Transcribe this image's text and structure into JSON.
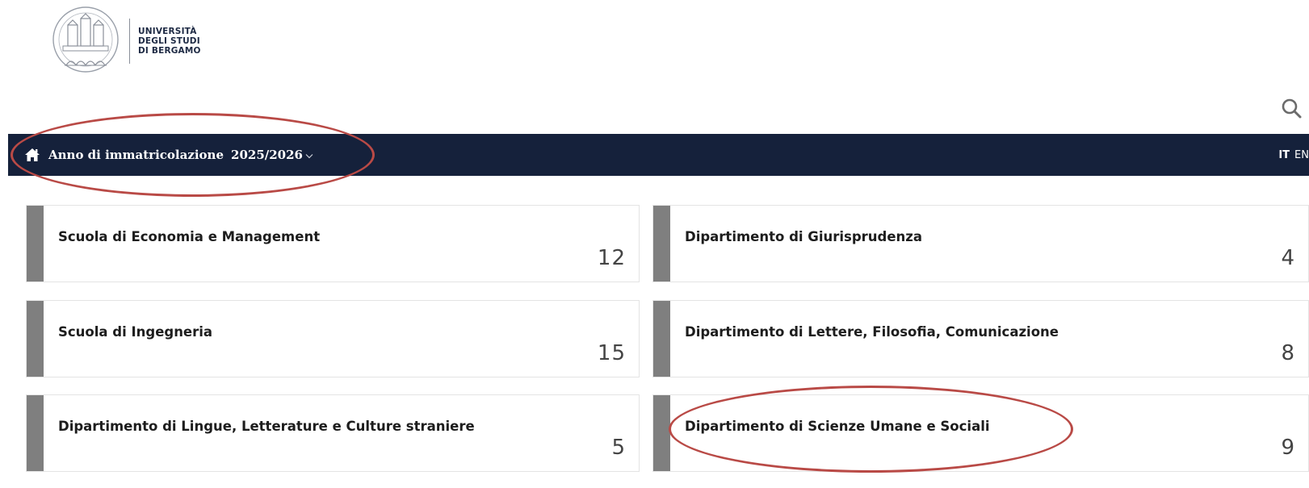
{
  "header": {
    "logo_lines": [
      "UNIVERSITÀ",
      "DEGLI STUDI",
      "DI BERGAMO"
    ],
    "search_icon": "search-icon"
  },
  "nav": {
    "home_icon": "home-icon",
    "label": "Anno di immatricolazione",
    "year": "2025/2026",
    "year_dropdown_icon": "chevron-down-icon",
    "languages": [
      {
        "code": "IT",
        "active": true
      },
      {
        "code": "EN",
        "active": false
      }
    ]
  },
  "cards": [
    {
      "title": "Scuola di Economia e Management",
      "count": "12"
    },
    {
      "title": "Dipartimento di Giurisprudenza",
      "count": "4"
    },
    {
      "title": "Scuola di Ingegneria",
      "count": "15"
    },
    {
      "title": "Dipartimento di Lettere, Filosofia, Comunicazione",
      "count": "8"
    },
    {
      "title": "Dipartimento di Lingue, Letterature e Culture straniere",
      "count": "5"
    },
    {
      "title": "Dipartimento di Scienze Umane e Sociali",
      "count": "9"
    }
  ],
  "colors": {
    "navbar_bg": "#15213b",
    "card_bar": "#7f7f7f",
    "annotation": "#b94a46"
  }
}
